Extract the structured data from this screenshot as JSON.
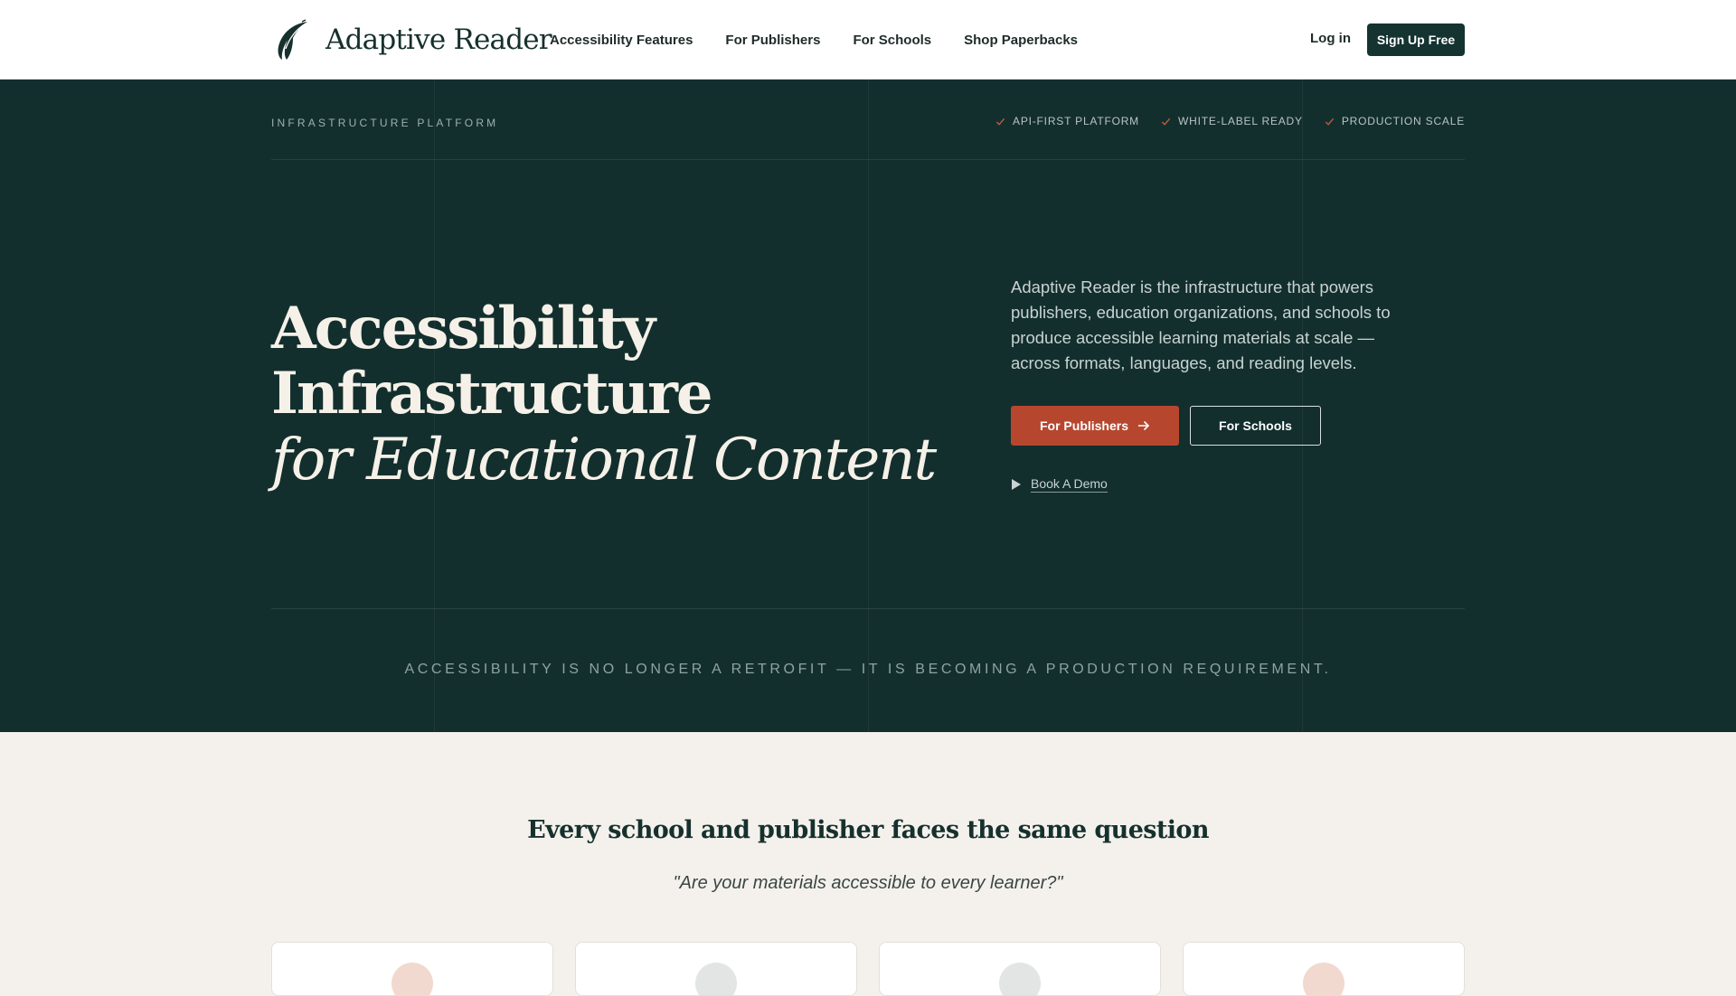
{
  "nav": {
    "brand": "Adaptive Reader",
    "links": [
      "Accessibility Features",
      "For Publishers",
      "For Schools",
      "Shop Paperbacks"
    ],
    "login": "Log in",
    "signup": "Sign Up Free"
  },
  "hero": {
    "eyebrow": "INFRASTRUCTURE PLATFORM",
    "badges": [
      "API-FIRST PLATFORM",
      "WHITE-LABEL READY",
      "PRODUCTION SCALE"
    ],
    "headline_line1": "Accessibility",
    "headline_line2": "Infrastructure",
    "headline_line3": "for Educational Content",
    "description": "Adaptive Reader is the infrastructure that powers publishers, education organizations, and schools to produce accessible learning materials at scale — across formats, languages, and reading levels.",
    "primary_cta": "For Publishers",
    "secondary_cta": "For Schools",
    "demo_link": "Book A Demo",
    "tagline": "ACCESSIBILITY IS NO LONGER A RETROFIT — IT IS BECOMING A PRODUCTION REQUIREMENT."
  },
  "section": {
    "title": "Every school and publisher faces the same question",
    "quote": "\"Are your materials accessible to every learner?\""
  },
  "colors": {
    "dark_green": "#122f2e",
    "accent_rust": "#b6472e",
    "cream": "#f4f1ec",
    "card_dot_1": "#f1d9cf",
    "card_dot_2": "#e2e5e4",
    "card_dot_3": "#e2e5e4",
    "card_dot_4": "#f1d9cf"
  },
  "icons": {
    "logo": "quill-feather-icon",
    "badge": "check-icon",
    "cta_arrow": "arrow-right-icon",
    "demo": "play-icon"
  }
}
